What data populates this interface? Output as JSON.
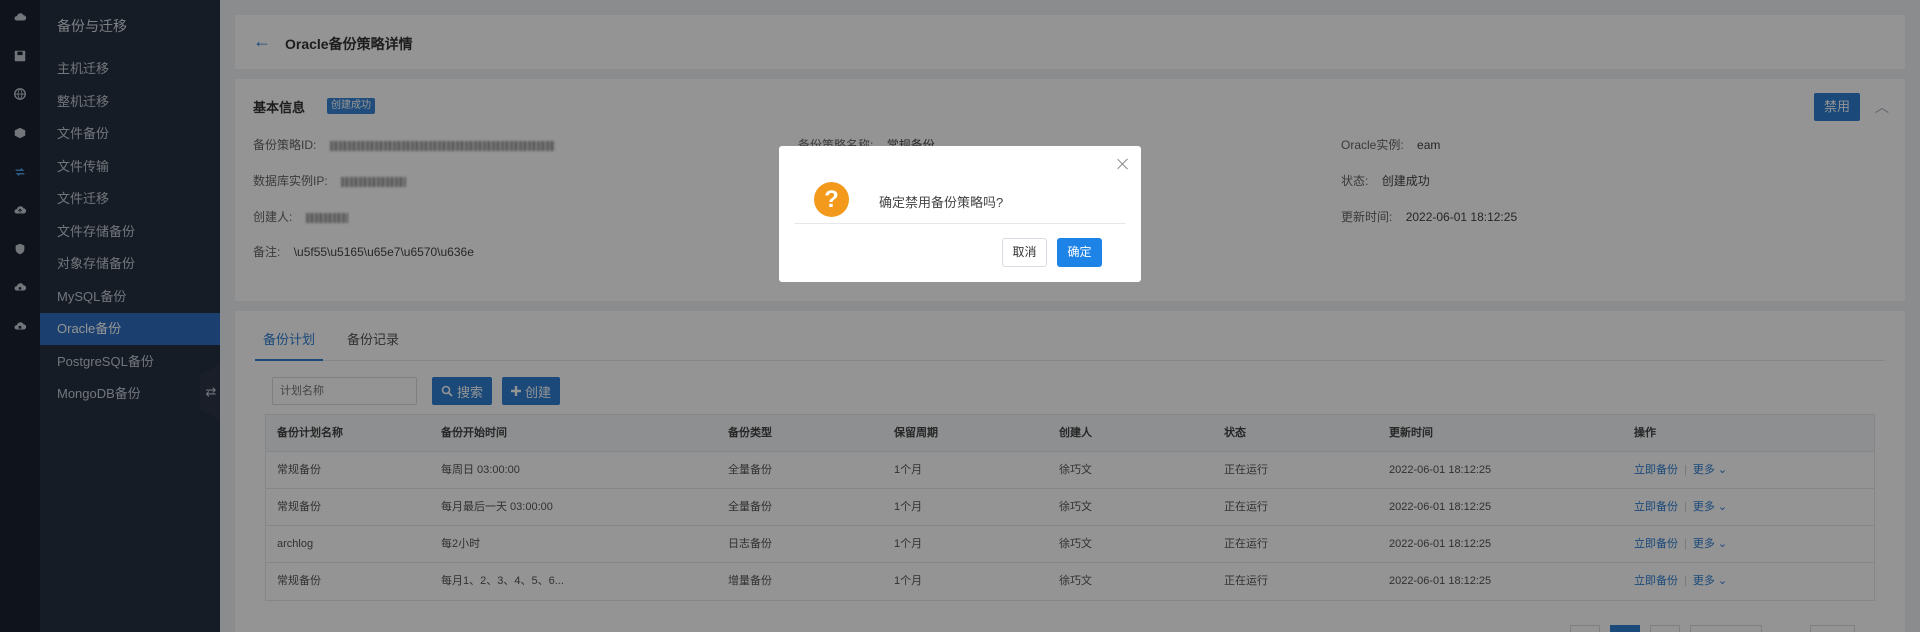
{
  "rail": {
    "icons": [
      "cloud-icon",
      "save-icon",
      "globe-icon",
      "box-icon",
      "migration-icon",
      "cloud-upload-icon",
      "shield-icon",
      "cloud-sync-icon",
      "cloud-lock-icon"
    ]
  },
  "sidebar": {
    "title": "备份与迁移",
    "items": [
      {
        "label": "主机迁移"
      },
      {
        "label": "整机迁移"
      },
      {
        "label": "文件备份"
      },
      {
        "label": "文件传输"
      },
      {
        "label": "文件迁移"
      },
      {
        "label": "文件存储备份"
      },
      {
        "label": "对象存储备份"
      },
      {
        "label": "MySQL备份"
      },
      {
        "label": "Oracle备份"
      },
      {
        "label": "PostgreSQL备份"
      },
      {
        "label": "MongoDB备份"
      }
    ],
    "active_index": 8,
    "collapse_glyph": "⇄"
  },
  "header": {
    "back_glyph": "←",
    "title": "Oracle备份策略详情"
  },
  "info": {
    "title": "基本信息",
    "badge": "创建成功",
    "disable_label": "禁用",
    "collapse_glyph": "︿",
    "fields": {
      "policy_id_label": "备份策略ID:",
      "db_ip_label": "数据库实例IP:",
      "creator_label": "创建人:",
      "remark_label": "备注:",
      "remark_value": "\\u5f55\\u5165\\u65e7\\u6570\\u636e",
      "policy_name_label": "备份策略名称:",
      "policy_name_value": "常规备份",
      "oracle_instance_label": "Oracle实例:",
      "oracle_instance_value": "eam",
      "status_label": "状态:",
      "status_value": "创建成功",
      "updated_label": "更新时间:",
      "updated_value": "2022-06-01 18:12:25"
    }
  },
  "plan": {
    "tabs": [
      {
        "label": "备份计划"
      },
      {
        "label": "备份记录"
      }
    ],
    "search_placeholder": "计划名称",
    "search_label": "搜索",
    "create_label": "创建",
    "columns": [
      "备份计划名称",
      "备份开始时间",
      "备份类型",
      "保留周期",
      "创建人",
      "状态",
      "更新时间",
      "操作"
    ],
    "rows": [
      {
        "name": "常规备份",
        "start": "每周日 03:00:00",
        "type": "全量备份",
        "retention": "1个月",
        "creator": "徐巧文",
        "status": "正在运行",
        "updated": "2022-06-01 18:12:25",
        "op1": "立即备份",
        "op2": "更多"
      },
      {
        "name": "常规备份",
        "start": "每月最后一天 03:00:00",
        "type": "全量备份",
        "retention": "1个月",
        "creator": "徐巧文",
        "status": "正在运行",
        "updated": "2022-06-01 18:12:25",
        "op1": "立即备份",
        "op2": "更多"
      },
      {
        "name": "archlog",
        "start": "每2小时",
        "type": "日志备份",
        "retention": "1个月",
        "creator": "徐巧文",
        "status": "正在运行",
        "updated": "2022-06-01 18:12:25",
        "op1": "立即备份",
        "op2": "更多"
      },
      {
        "name": "常规备份",
        "start": "每月1、2、3、4、5、6...",
        "type": "增量备份",
        "retention": "1个月",
        "creator": "徐巧文",
        "status": "正在运行",
        "updated": "2022-06-01 18:12:25",
        "op1": "立即备份",
        "op2": "更多"
      }
    ]
  },
  "dialog": {
    "icon_glyph": "?",
    "message": "确定禁用备份策略吗?",
    "cancel_label": "取消",
    "ok_label": "确定"
  },
  "colors": {
    "accent": "#2d7fd3",
    "sidebar_bg": "#263142",
    "rail_bg": "#1b2230",
    "warning": "#f39a1d"
  }
}
